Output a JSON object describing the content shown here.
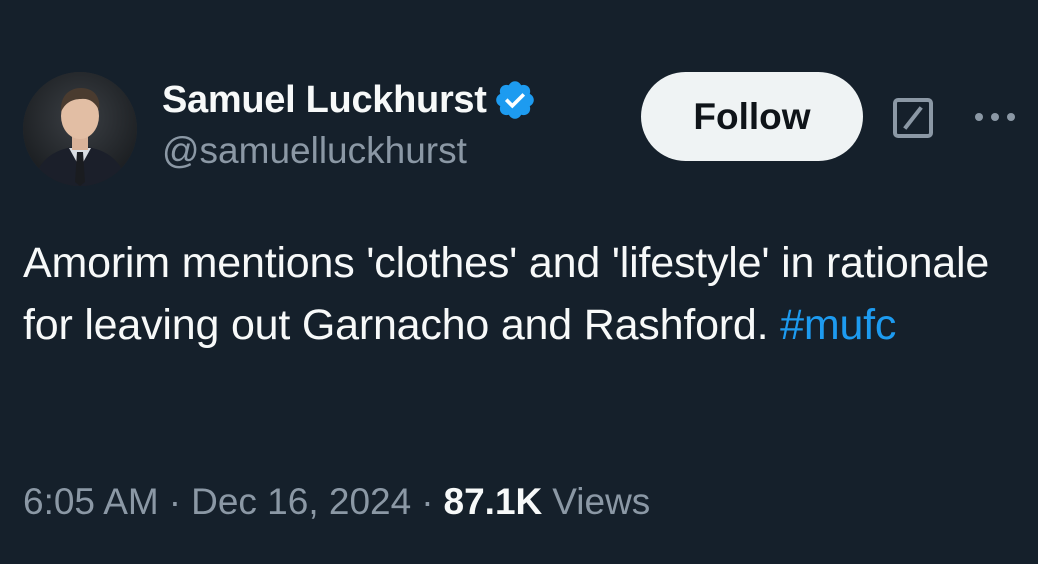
{
  "author": {
    "display_name": "Samuel Luckhurst",
    "handle": "@samuelluckhurst",
    "verified": true,
    "avatar_icon": "profile-photo"
  },
  "actions": {
    "follow_label": "Follow",
    "grok_icon": "grok-icon",
    "more_icon": "more-icon"
  },
  "tweet": {
    "text": "Amorim mentions 'clothes' and 'lifestyle' in rationale for leaving out Garnacho and Rashford.",
    "hashtag": "#mufc"
  },
  "meta": {
    "time": "6:05 AM",
    "separator": "·",
    "date": "Dec 16, 2024",
    "views_count": "87.1K",
    "views_label": "Views"
  },
  "colors": {
    "background": "#15202b",
    "text": "#f7f9f9",
    "secondary_text": "#8b98a5",
    "link": "#1d9bf0",
    "verified_badge": "#1d9bf0",
    "follow_button_bg": "#eff3f4"
  }
}
